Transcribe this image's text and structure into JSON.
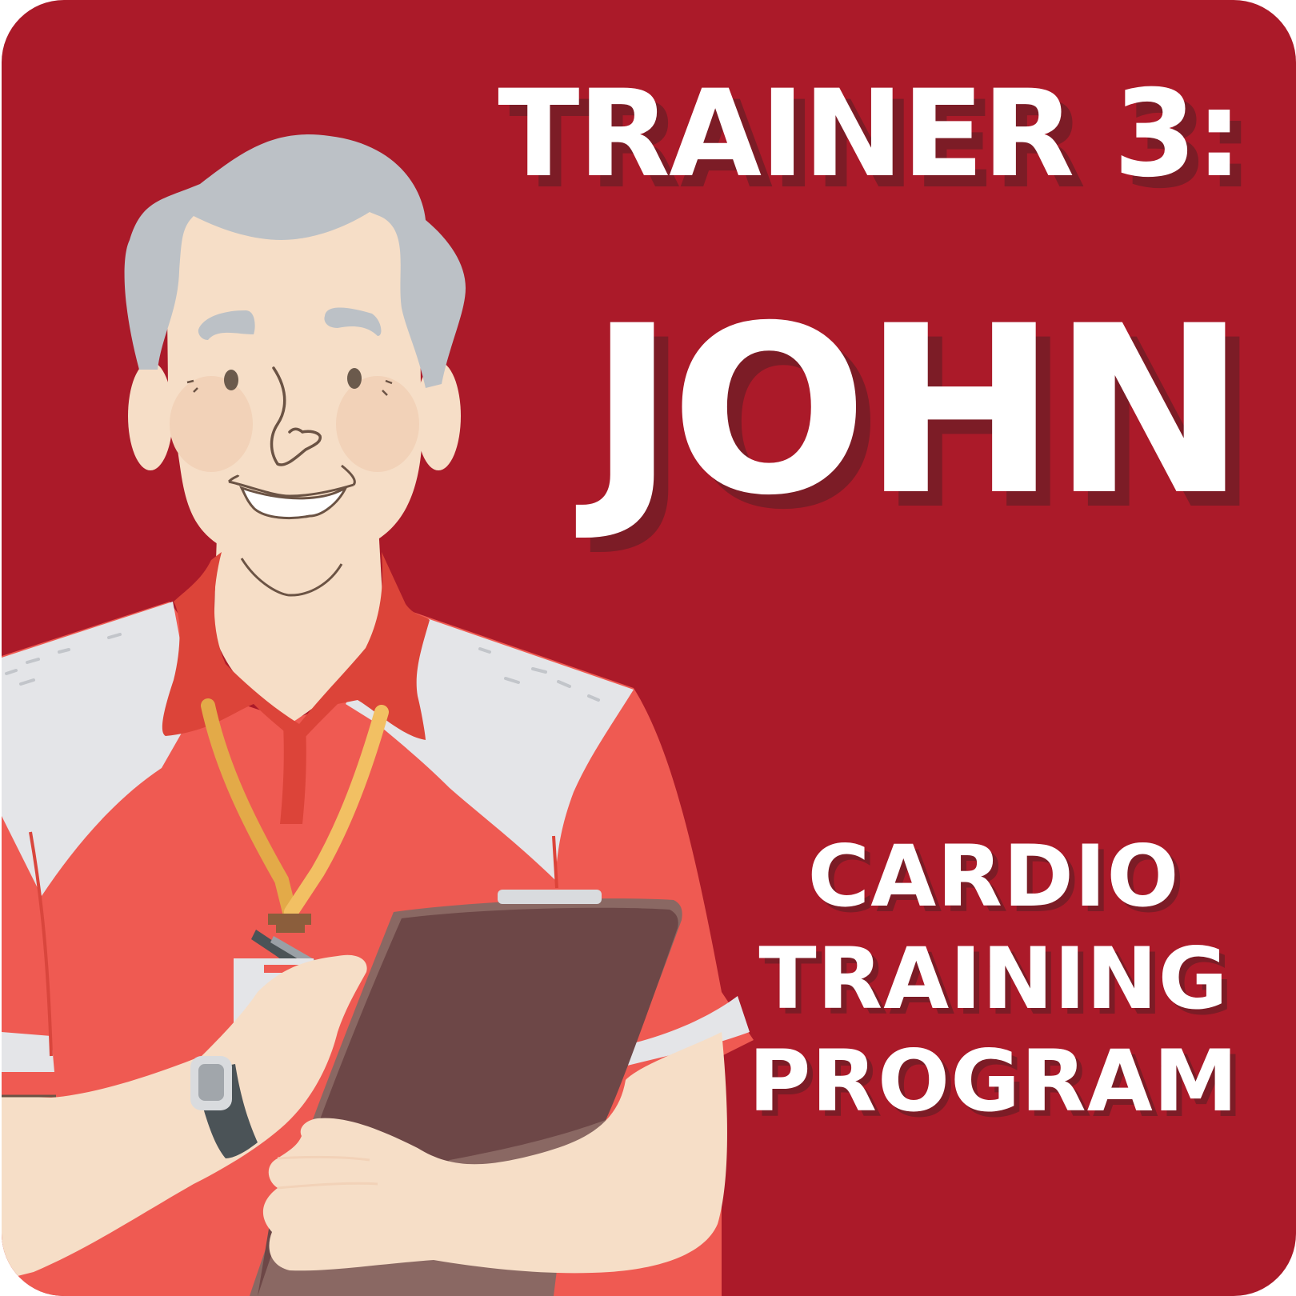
{
  "card": {
    "heading": "TRAINER 3:",
    "name": "JOHN",
    "program_lines": [
      "CARDIO",
      "TRAINING",
      "PROGRAM"
    ]
  },
  "colors": {
    "background": "#ab1a29",
    "text": "#ffffff",
    "text_shadow": "#7c1c26",
    "shirt": "#ef5a52",
    "collar": "#dc4439",
    "sleeve": "#e4e5e8",
    "skin": "#f6dec7",
    "hair": "#bcc1c6",
    "clipboard": "#6e4848",
    "lanyard": "#e8b04e"
  },
  "icons": [
    "trainer-illustration",
    "clipboard-icon",
    "pen-icon",
    "wristwatch-icon",
    "lanyard-icon"
  ]
}
